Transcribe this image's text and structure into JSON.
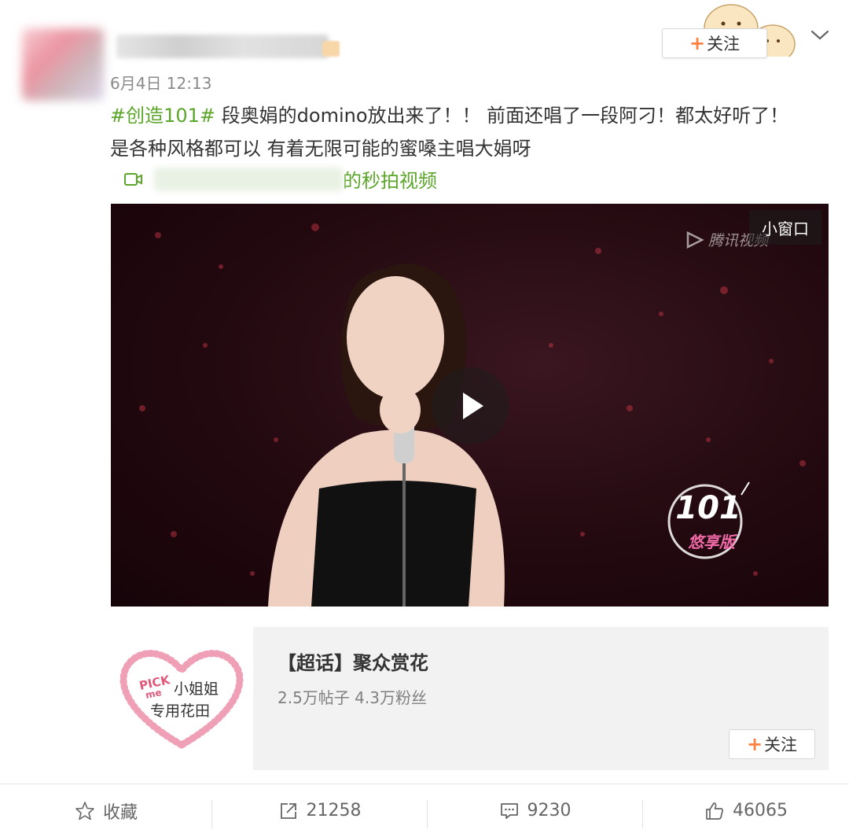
{
  "post": {
    "time": "6月4日 12:13",
    "hashtag": "#创造101#",
    "text_line1": " 段奥娟的domino放出来了！！ 前面还唱了一段阿刁！都太好听了！",
    "text_line2": "是各种风格都可以 有着无限可能的蜜嗓主唱大娟呀",
    "video_link_suffix": "的秒拍视频"
  },
  "header": {
    "follow_label": "关注",
    "follow_plus": "+"
  },
  "video": {
    "mini_window_label": "小窗口",
    "watermark": "腾讯视频",
    "logo_number": "101",
    "logo_caption": "悠享版"
  },
  "topic_card": {
    "title": "【超话】聚众赏花",
    "stats": "2.5万帖子 4.3万粉丝",
    "follow_label": "关注",
    "follow_plus": "+",
    "thumb_pick": "PICK",
    "thumb_me": "me",
    "thumb_line1": "小姐姐",
    "thumb_line2": "专用花田"
  },
  "footer": {
    "favorite_label": "收藏",
    "repost_count": "21258",
    "comment_count": "9230",
    "like_count": "46065"
  },
  "colors": {
    "hashtag_green": "#5ba62a",
    "accent_orange": "#ff8140",
    "card_bg": "#f2f2f2"
  }
}
